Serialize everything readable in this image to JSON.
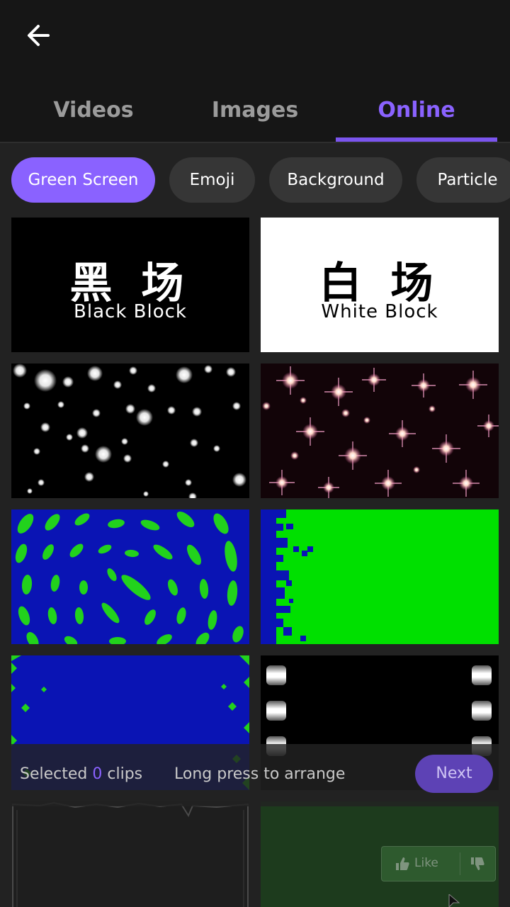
{
  "tabs": [
    {
      "label": "Videos",
      "active": false
    },
    {
      "label": "Images",
      "active": false
    },
    {
      "label": "Online",
      "active": true
    }
  ],
  "chips": [
    {
      "label": "Green Screen",
      "active": true
    },
    {
      "label": "Emoji",
      "active": false
    },
    {
      "label": "Background",
      "active": false
    },
    {
      "label": "Particle",
      "active": false
    }
  ],
  "thumbs": {
    "black_block": {
      "cn": "黑 场",
      "en": "Black Block"
    },
    "white_block": {
      "cn": "白 场",
      "en": "White Block"
    }
  },
  "bottom_bar": {
    "selected_prefix": "Selected",
    "selected_count": "0",
    "selected_suffix": "clips",
    "hint": "Long press to arrange",
    "next_label": "Next"
  },
  "overlay": {
    "like_label": "Like"
  },
  "colors": {
    "accent": "#8a62ff",
    "chroma_green": "#00e000",
    "chroma_blue": "#0a14b4"
  },
  "icons": [
    "back-arrow-icon",
    "thumbs-up-icon",
    "thumbs-down-icon",
    "cursor-icon"
  ]
}
